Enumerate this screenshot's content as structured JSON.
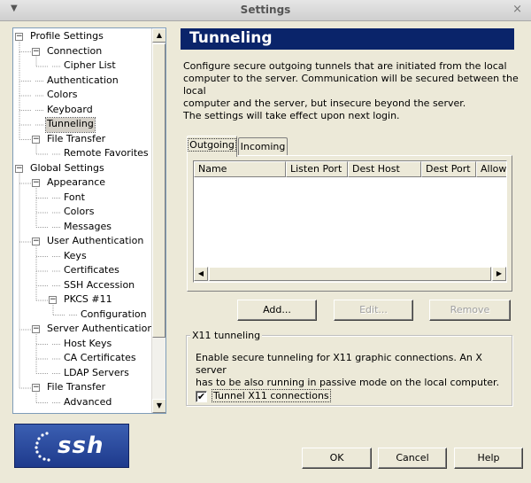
{
  "window": {
    "title": "Settings",
    "menu_glyph": "▼",
    "close_glyph": "×"
  },
  "tree": {
    "nodes": [
      {
        "label": "Profile Settings",
        "expander": "−"
      },
      {
        "label": "Connection",
        "expander": "−"
      },
      {
        "label": "Cipher List"
      },
      {
        "label": "Authentication"
      },
      {
        "label": "Colors"
      },
      {
        "label": "Keyboard"
      },
      {
        "label": "Tunneling",
        "selected": true
      },
      {
        "label": "File Transfer",
        "expander": "−"
      },
      {
        "label": "Remote Favorites"
      },
      {
        "label": "Global Settings",
        "expander": "−"
      },
      {
        "label": "Appearance",
        "expander": "−"
      },
      {
        "label": "Font"
      },
      {
        "label": "Colors"
      },
      {
        "label": "Messages"
      },
      {
        "label": "User Authentication",
        "expander": "−"
      },
      {
        "label": "Keys"
      },
      {
        "label": "Certificates"
      },
      {
        "label": "SSH Accession"
      },
      {
        "label": "PKCS #11",
        "expander": "−"
      },
      {
        "label": "Configuration"
      },
      {
        "label": "Server Authentication",
        "expander": "−"
      },
      {
        "label": "Host Keys"
      },
      {
        "label": "CA Certificates"
      },
      {
        "label": "LDAP Servers"
      },
      {
        "label": "File Transfer",
        "expander": "−"
      },
      {
        "label": "Advanced"
      }
    ]
  },
  "logo": {
    "text": "ssh",
    "bg_color": "#2a4a9e"
  },
  "panel": {
    "title": "Tunneling",
    "description": [
      "Configure secure outgoing tunnels that are initiated from the local",
      "computer to the server. Communication will be secured between the local",
      "computer and the server, but insecure beyond the server.",
      "The settings will take effect upon next login."
    ],
    "tabs": [
      {
        "label": "Outgoing",
        "active": true
      },
      {
        "label": "Incoming",
        "active": false
      }
    ],
    "columns": [
      "Name",
      "Listen Port",
      "Dest Host",
      "Dest Port",
      "Allow"
    ],
    "buttons": {
      "add": "Add...",
      "edit": "Edit...",
      "remove": "Remove"
    },
    "x11": {
      "title": "X11 tunneling",
      "description": [
        "Enable secure tunneling for X11 graphic connections. An X server",
        "has to be also running in passive mode on the local computer."
      ],
      "checkbox_label": "Tunnel X11 connections",
      "checked": true,
      "check_glyph": "✔"
    }
  },
  "footer": {
    "ok": "OK",
    "cancel": "Cancel",
    "help": "Help"
  },
  "colors": {
    "header_bg": "#0a246a",
    "window_bg": "#ece9d8"
  }
}
